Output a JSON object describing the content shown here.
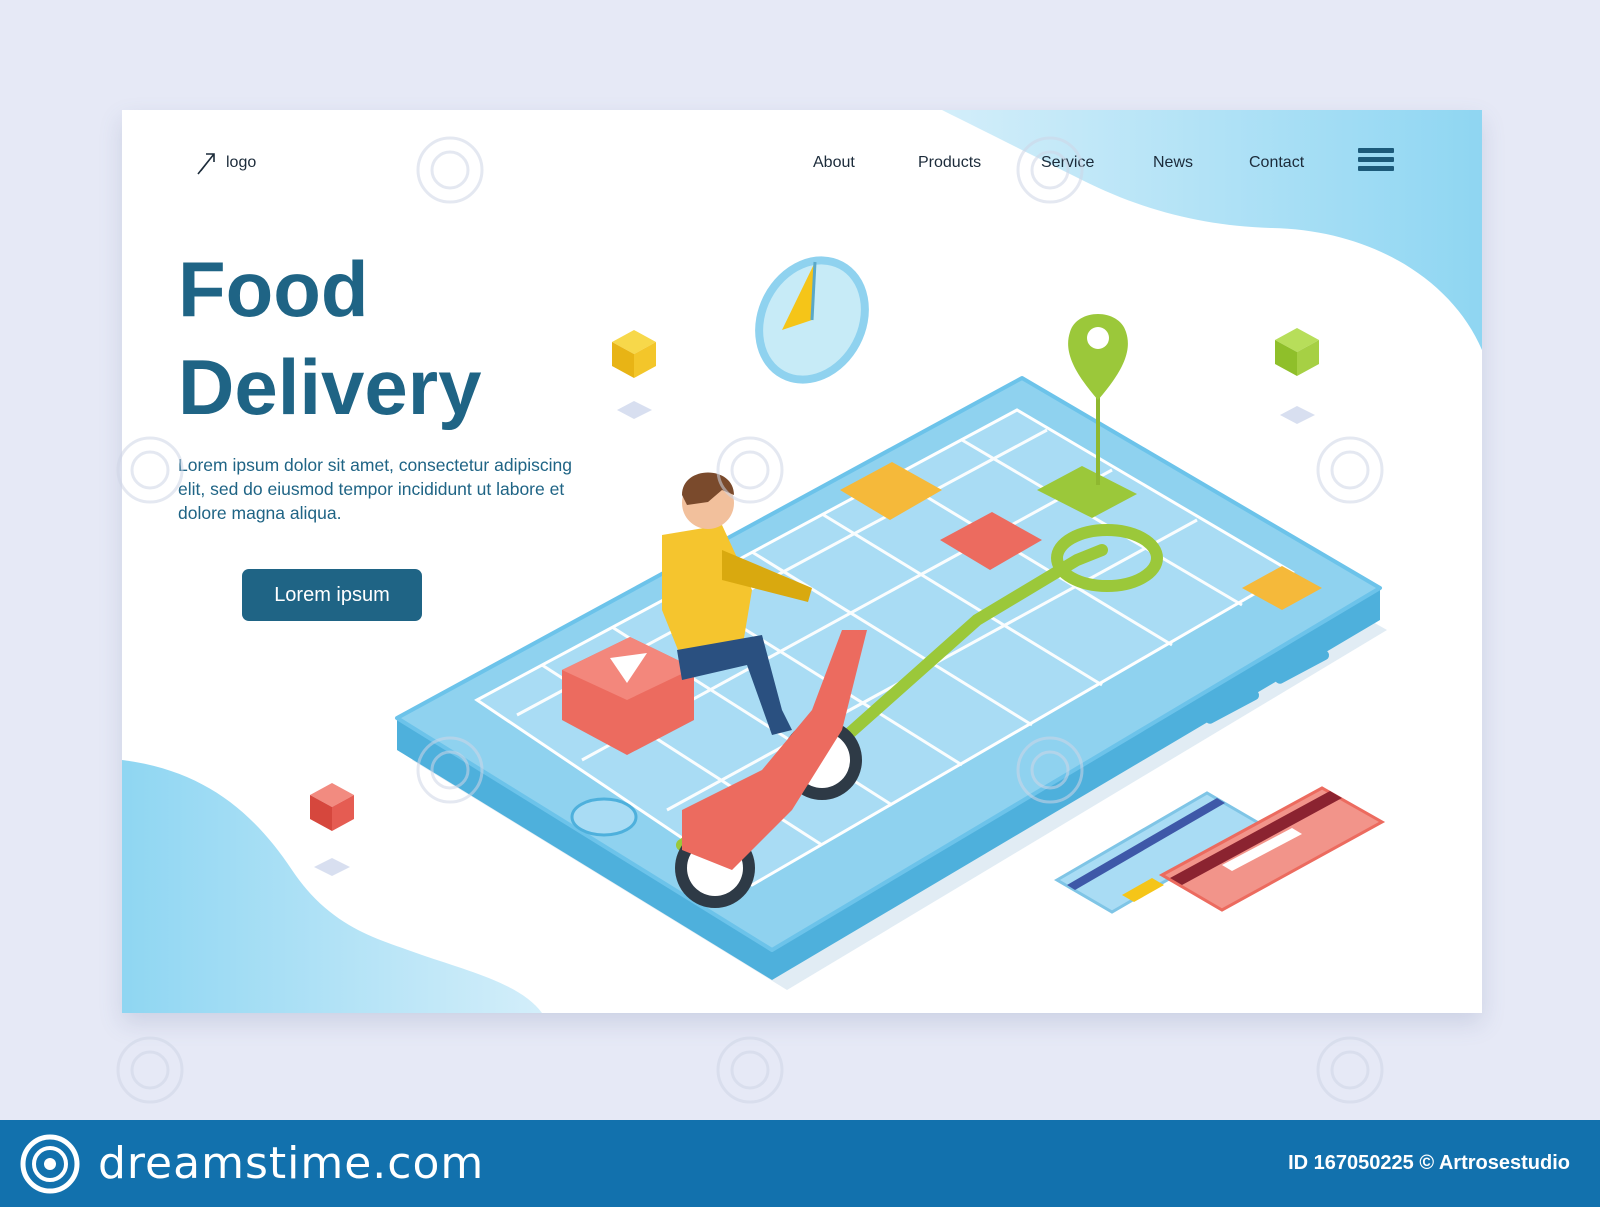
{
  "header": {
    "logo_text": "logo",
    "logo_icon": "arrow-icon",
    "nav": [
      "About",
      "Products",
      "Service",
      "News",
      "Contact"
    ],
    "menu_icon": "hamburger-menu-icon"
  },
  "hero": {
    "title_line1": "Food",
    "title_line2": "Delivery",
    "text": "Lorem ipsum dolor sit amet, consectetur adipiscing elit, sed do eiusmod tempor incididunt ut labore et dolore magna aliqua.",
    "button_label": "Lorem ipsum"
  },
  "footer": {
    "wordmark": "dreamstime.com",
    "credit": "ID 167050225 © Artrosestudio"
  },
  "colors": {
    "title": "#1f6485",
    "button": "#1f6485",
    "phone": "#8fd2ef",
    "scooter": "#ec6b5f",
    "route": "#9bc83a",
    "footer_bar": "#1271ad",
    "page_bg": "#e6e9f6"
  }
}
